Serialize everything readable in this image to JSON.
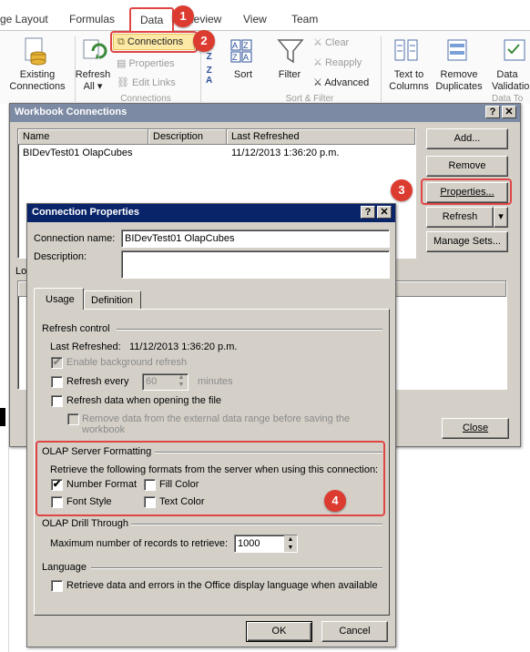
{
  "ribbon": {
    "tabs": [
      "ge Layout",
      "Formulas",
      "Data",
      "Review",
      "View",
      "Team"
    ],
    "existing_connections": [
      "Existing",
      "Connections"
    ],
    "refresh_all": [
      "Refresh",
      "All"
    ],
    "connections_btn": "Connections",
    "properties_btn": "Properties",
    "edit_links_btn": "Edit Links",
    "group_connections": "Connections",
    "sort_btn": "Sort",
    "filter_btn": "Filter",
    "clear_btn": "Clear",
    "reapply_btn": "Reapply",
    "advanced_btn": "Advanced",
    "group_sort_filter": "Sort & Filter",
    "text_to_columns": [
      "Text to",
      "Columns"
    ],
    "remove_duplicates": [
      "Remove",
      "Duplicates"
    ],
    "data_validation": [
      "Data",
      "Validatio"
    ],
    "group_data_tools": "Data To"
  },
  "badges": [
    "1",
    "2",
    "3",
    "4"
  ],
  "workbook_connections": {
    "title": "Workbook Connections",
    "help": "?",
    "close": "✕",
    "columns": [
      "Name",
      "Description",
      "Last Refreshed"
    ],
    "rows": [
      {
        "name": "BIDevTest01 OlapCubes",
        "description": "",
        "last_refreshed": "11/12/2013  1:36:20 p.m."
      }
    ],
    "add_btn": "Add...",
    "remove_btn": "Remove",
    "properties_btn": "Properties...",
    "refresh_btn": "Refresh",
    "manage_sets_btn": "Manage Sets...",
    "close_btn": "Close",
    "lower_label": "Lo"
  },
  "connection_properties": {
    "title": "Connection Properties",
    "help": "?",
    "close": "✕",
    "connection_name_label": "Connection name:",
    "connection_name_value": "BIDevTest01 OlapCubes",
    "description_label": "Description:",
    "description_value": "",
    "tabs": [
      "Usage",
      "Definition"
    ],
    "refresh_control": {
      "heading": "Refresh control",
      "last_refreshed_label": "Last Refreshed:",
      "last_refreshed_value": "11/12/2013  1:36:20 p.m.",
      "enable_background": "Enable background refresh",
      "refresh_every": "Refresh every",
      "refresh_every_value": "60",
      "minutes": "minutes",
      "refresh_on_open": "Refresh data when opening the file",
      "remove_data": [
        "Remove data from the external data range before saving the",
        "workbook"
      ]
    },
    "olap_formatting": {
      "heading": "OLAP Server Formatting",
      "intro": "Retrieve the following formats from the server when using this connection:",
      "number_format": "Number Format",
      "fill_color": "Fill Color",
      "font_style": "Font Style",
      "text_color": "Text Color"
    },
    "olap_drill": {
      "heading": "OLAP Drill Through",
      "max_records_label": "Maximum number of records to retrieve:",
      "max_records_value": "1000"
    },
    "language": {
      "heading": "Language",
      "retrieve_label": "Retrieve data and errors in the Office display language when available"
    },
    "ok_btn": "OK",
    "cancel_btn": "Cancel"
  },
  "colors": {
    "title_bar": "#0a246a",
    "highlight": "#e04545",
    "badge": "#dc3b30",
    "dialog_face": "#d4d0c8"
  }
}
